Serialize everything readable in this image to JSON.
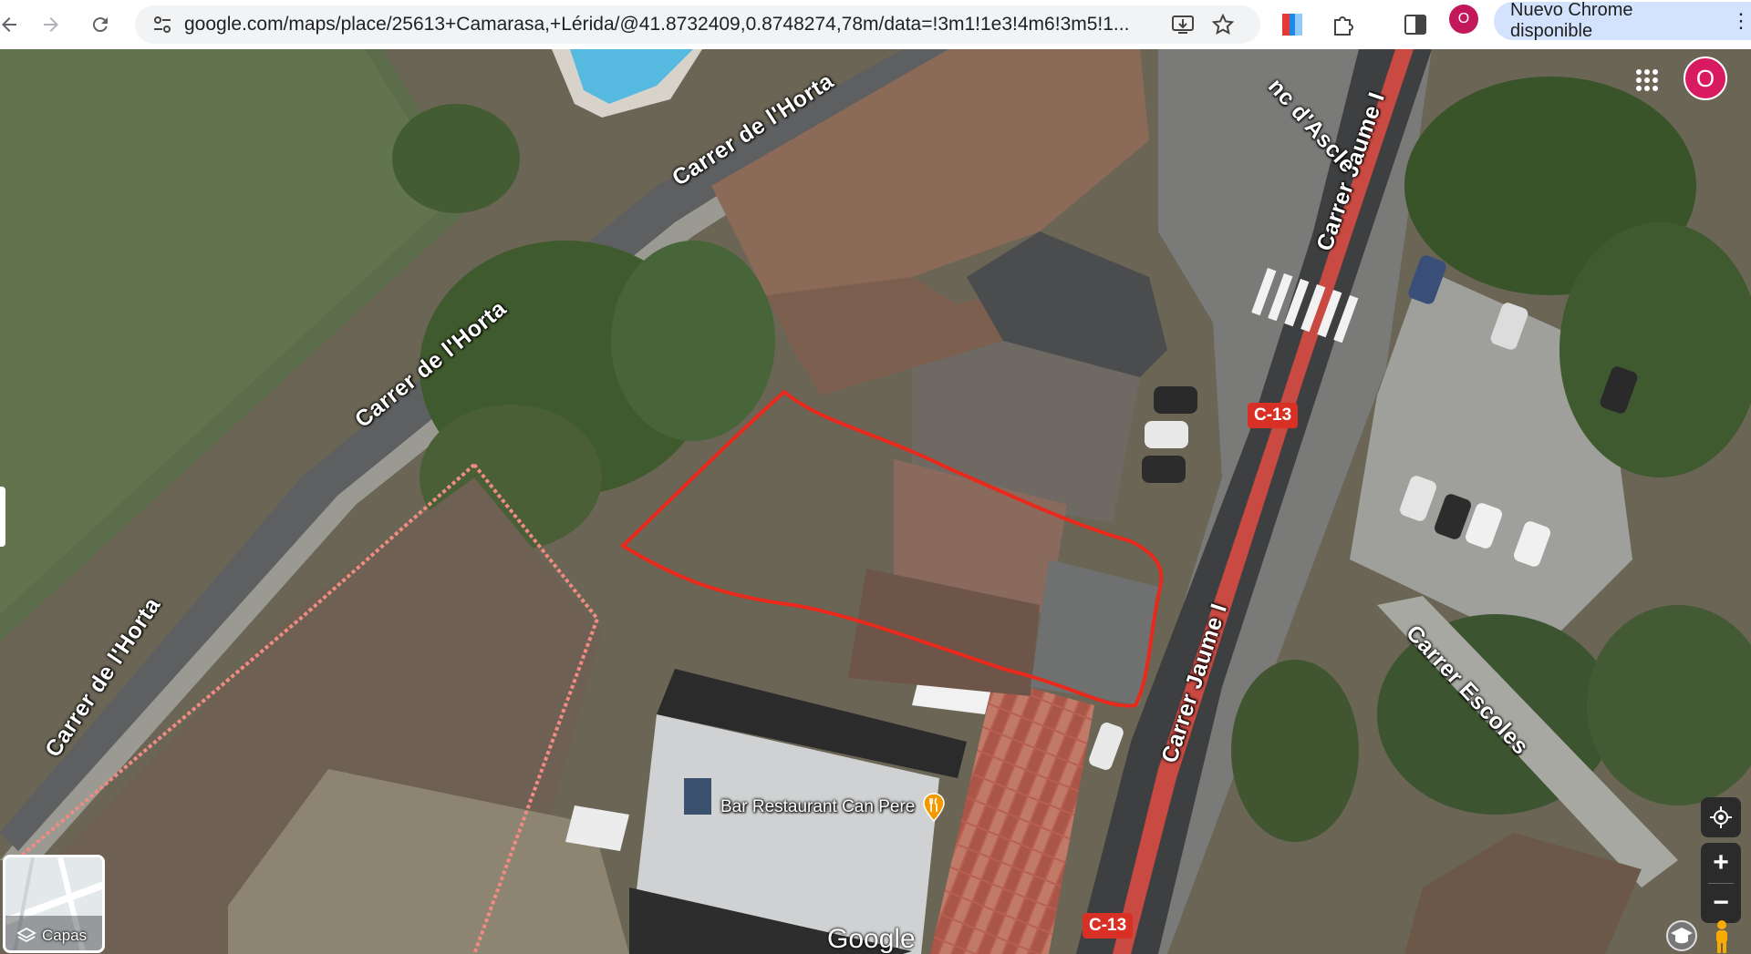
{
  "browser": {
    "url": "google.com/maps/place/25613+Camarasa,+Lérida/@41.8732409,0.8748274,78m/data=!3m1!1e3!4m6!3m5!1...",
    "profile_initial": "O",
    "update_label": "Nuevo Chrome disponible",
    "icons": [
      "back-icon",
      "forward-icon",
      "reload-icon",
      "site-settings-icon",
      "install-icon",
      "bookmark-star-icon",
      "extension-icon",
      "puzzle-icon",
      "side-panel-icon",
      "menu-dots-icon"
    ]
  },
  "map": {
    "mode": "satellite",
    "streets": {
      "horta_1": "Carrer de l'Horta",
      "horta_2": "Carrer de l'Horta",
      "horta_3": "Carrer de l'Horta",
      "jaume_1": "Carrer Jaume I",
      "jaume_2": "Carrer Jaume I",
      "escoles": "Carrer Escoles",
      "ascle": "nc d'Ascle"
    },
    "road_shields": [
      "C-13",
      "C-13"
    ],
    "poi": {
      "name": "Bar Restaurant Can Pere",
      "icon": "restaurant-icon"
    },
    "account_initial": "O",
    "layers_label": "Capas",
    "zoom_in": "+",
    "zoom_out": "−",
    "attribution": "Google",
    "colors": {
      "selection_outline": "#e8291c",
      "parcel_outline": "#f28b82",
      "road_shield": "#d93025",
      "avatar": "#d81b60"
    }
  }
}
